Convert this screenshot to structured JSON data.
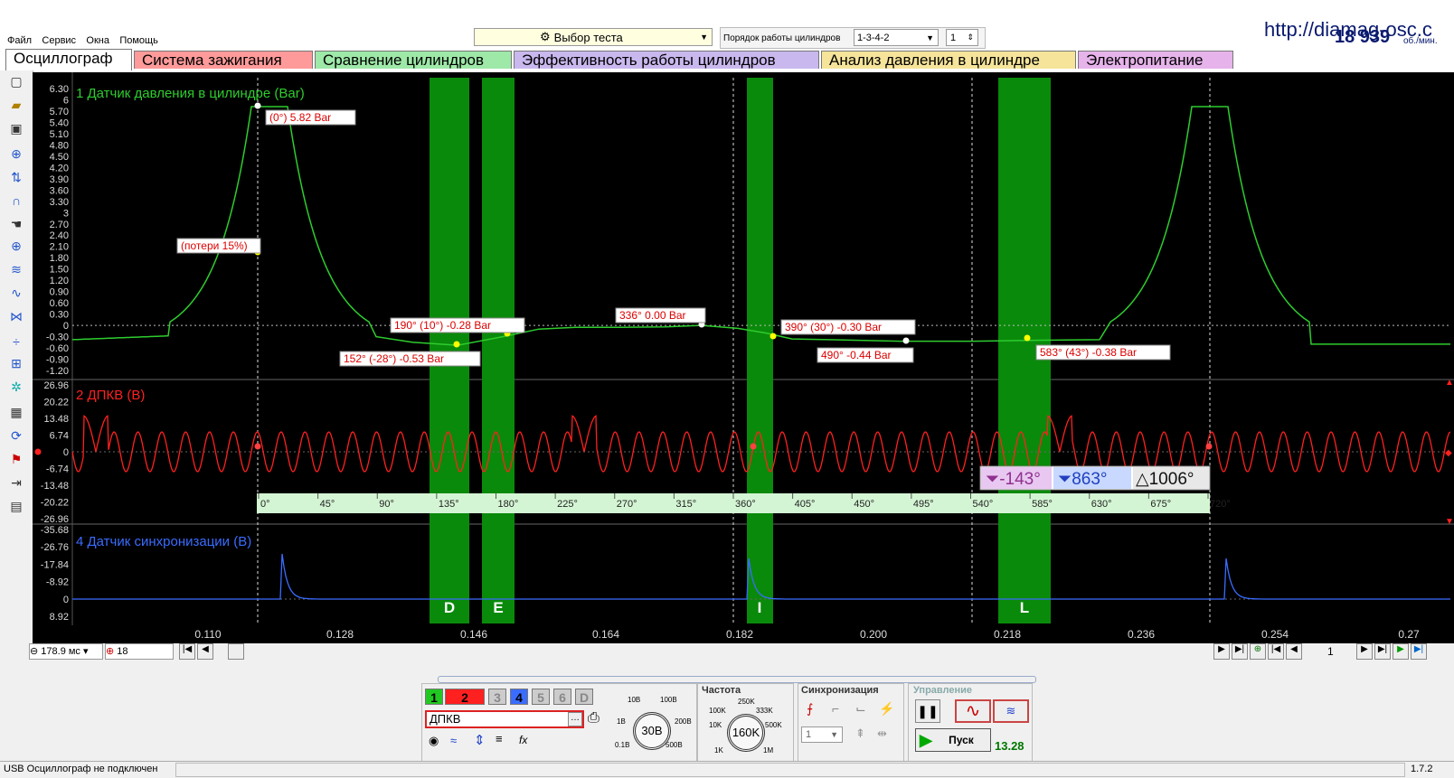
{
  "menu": [
    "Файл",
    "Сервис",
    "Окна",
    "Помощь"
  ],
  "test_select": {
    "label": "Выбор теста"
  },
  "cyl_order": {
    "label": "Порядок работы цилиндров",
    "value": "1-3-4-2",
    "cyl": "1"
  },
  "site": {
    "url": "http://diamag-osc.c",
    "rpm": "18 939",
    "rpm_unit": "об./мин."
  },
  "tabs": [
    {
      "label": "Осциллограф",
      "color": "#ffffff"
    },
    {
      "label": "Система зажигания",
      "color": "#ff9a9a"
    },
    {
      "label": "Сравнение цилиндров",
      "color": "#9ee8a8"
    },
    {
      "label": "Эффективность работы цилиндров",
      "color": "#c9b8ee"
    },
    {
      "label": "Анализ давления в цилиндре",
      "color": "#f5e49a"
    },
    {
      "label": "Электропитание",
      "color": "#e6b3ea"
    }
  ],
  "channels": {
    "ch1": {
      "title": "1 Датчик давления в цилиндре (Bar)",
      "color": "#2ecc2e",
      "ticks": [
        "6.30",
        "6",
        "5.70",
        "5.40",
        "5.10",
        "4.80",
        "4.50",
        "4.20",
        "3.90",
        "3.60",
        "3.30",
        "3",
        "2.70",
        "2.40",
        "2.10",
        "1.80",
        "1.50",
        "1.20",
        "0.90",
        "0.60",
        "0.30",
        "0",
        "-0.30",
        "-0.60",
        "-0.90",
        "-1.20"
      ]
    },
    "ch2": {
      "title": "2 ДПКВ (В)",
      "color": "#ff2020",
      "ticks": [
        "26.96",
        "20.22",
        "13.48",
        "6.74",
        "0",
        "-6.74",
        "-13.48",
        "-20.22",
        "-26.96"
      ]
    },
    "ch4": {
      "title": "4 Датчик синхронизации (В)",
      "color": "#3a6cff",
      "ticks": [
        "-35.68",
        "-26.76",
        "-17.84",
        "-8.92",
        "0",
        "8.92"
      ]
    }
  },
  "annotations": [
    "(0°) 5.82 Bar",
    "(потери 15%)",
    "190° (10°) -0.28 Bar",
    "152° (-28°) -0.53 Bar",
    "336° 0.00 Bar",
    "390° (30°) -0.30 Bar",
    "490° -0.44 Bar",
    "583° (43°) -0.38 Bar"
  ],
  "zones": [
    "D",
    "E",
    "I",
    "L"
  ],
  "degree_scale": [
    "0°",
    "45°",
    "90°",
    "135°",
    "180°",
    "225°",
    "270°",
    "315°",
    "360°",
    "405°",
    "450°",
    "495°",
    "540°",
    "585°",
    "630°",
    "675°",
    "720°"
  ],
  "cursor": {
    "left": "-143°",
    "right": "863°",
    "delta": "1006°"
  },
  "time_axis": [
    "0.110",
    "0.128",
    "0.146",
    "0.164",
    "0.182",
    "0.200",
    "0.218",
    "0.236",
    "0.254",
    "0.27"
  ],
  "bottom": {
    "timebase": "178.9 мс",
    "zoom": "18",
    "page": "1",
    "channel_buttons": [
      "1",
      "2",
      "3",
      "4",
      "5",
      "6",
      "D"
    ],
    "channel_name": "ДПКВ",
    "volt_knob": "30В",
    "volt_labels": [
      "10В",
      "100В",
      "1В",
      "200В",
      "0.1В",
      "500В"
    ],
    "freq_title": "Частота",
    "freq_knob": "160K",
    "freq_labels": [
      "250K",
      "100K",
      "333K",
      "10K",
      "500K",
      "1K",
      "1M"
    ],
    "sync_title": "Синхронизация",
    "sync_value": "1",
    "control_title": "Управление",
    "start_label": "Пуск",
    "counter": "13.28",
    "status": "USB Осциллограф не подключен",
    "version": "1.7.2"
  }
}
